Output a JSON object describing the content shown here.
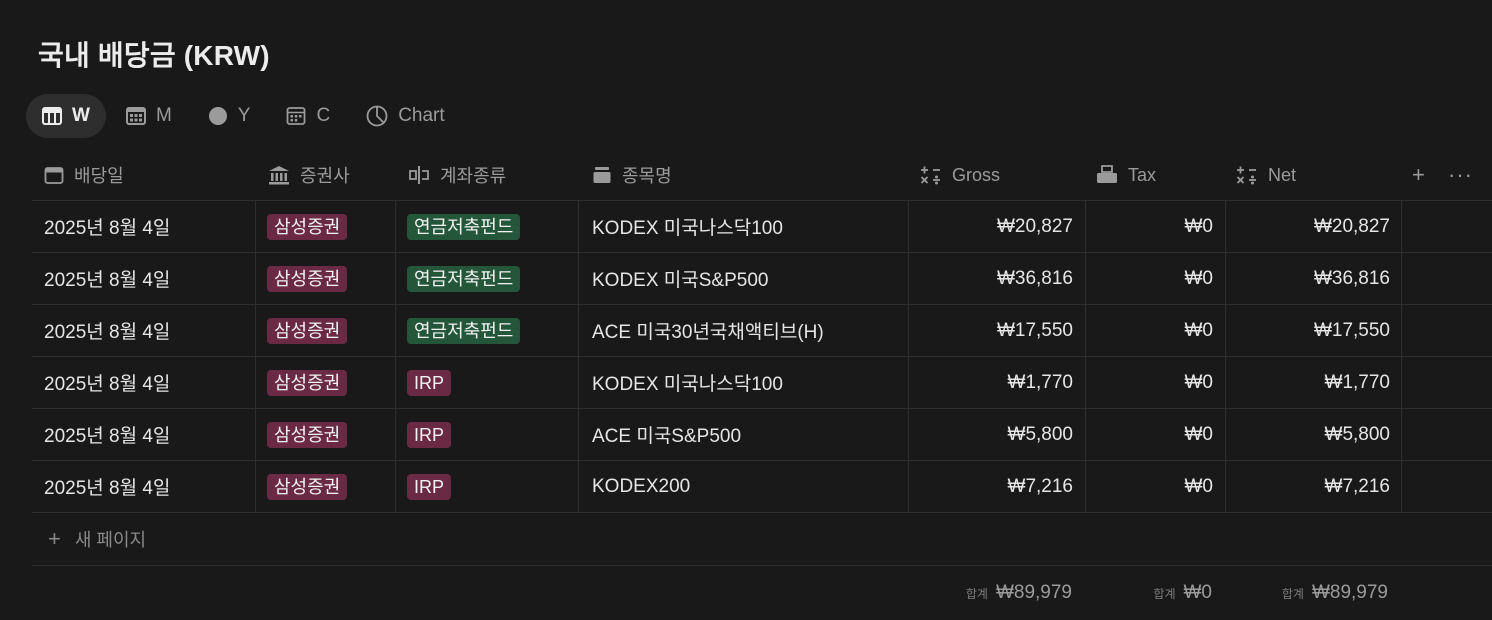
{
  "page": {
    "title": "국내 배당금 (KRW)"
  },
  "tabs": [
    {
      "label": "W",
      "icon": "calendar-week-icon",
      "active": true
    },
    {
      "label": "M",
      "icon": "calendar-month-icon",
      "active": false
    },
    {
      "label": "Y",
      "icon": "circle-icon",
      "active": false
    },
    {
      "label": "C",
      "icon": "calendar-icon",
      "active": false
    },
    {
      "label": "Chart",
      "icon": "pie-chart-icon",
      "active": false
    }
  ],
  "columns": {
    "date": "배당일",
    "broker": "증권사",
    "account": "계좌종류",
    "name": "종목명",
    "gross": "Gross",
    "tax": "Tax",
    "net": "Net"
  },
  "rows": [
    {
      "date": "2025년 8월 4일",
      "broker": "삼성증권",
      "account": "연금저축펀드",
      "name": "KODEX 미국나스닥100",
      "gross": "₩20,827",
      "tax": "₩0",
      "net": "₩20,827"
    },
    {
      "date": "2025년 8월 4일",
      "broker": "삼성증권",
      "account": "연금저축펀드",
      "name": "KODEX 미국S&P500",
      "gross": "₩36,816",
      "tax": "₩0",
      "net": "₩36,816"
    },
    {
      "date": "2025년 8월 4일",
      "broker": "삼성증권",
      "account": "연금저축펀드",
      "name": "ACE 미국30년국채액티브(H)",
      "gross": "₩17,550",
      "tax": "₩0",
      "net": "₩17,550"
    },
    {
      "date": "2025년 8월 4일",
      "broker": "삼성증권",
      "account": "IRP",
      "name": "KODEX 미국나스닥100",
      "gross": "₩1,770",
      "tax": "₩0",
      "net": "₩1,770"
    },
    {
      "date": "2025년 8월 4일",
      "broker": "삼성증권",
      "account": "IRP",
      "name": "ACE 미국S&P500",
      "gross": "₩5,800",
      "tax": "₩0",
      "net": "₩5,800"
    },
    {
      "date": "2025년 8월 4일",
      "broker": "삼성증권",
      "account": "IRP",
      "name": "KODEX200",
      "gross": "₩7,216",
      "tax": "₩0",
      "net": "₩7,216"
    }
  ],
  "new_page_label": "새 페이지",
  "totals": {
    "label": "합계",
    "gross": "₩89,979",
    "tax": "₩0",
    "net": "₩89,979"
  },
  "colors": {
    "broker_tag": "#6b2a43",
    "account_pension": "#24573a",
    "account_irp": "#6b2a43"
  }
}
